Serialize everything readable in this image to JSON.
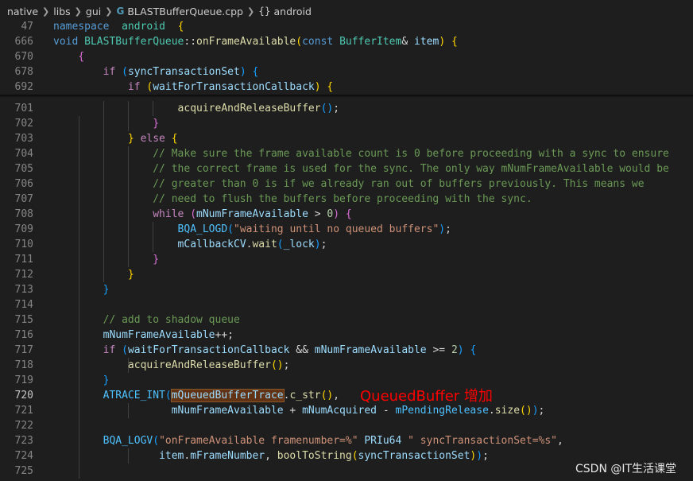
{
  "breadcrumb": {
    "items": [
      "native",
      "libs",
      "gui",
      "BLASTBufferQueue.cpp",
      "android"
    ],
    "file_icon": "cpp-file-icon",
    "symbol_icon": "namespace-braces-icon"
  },
  "editor": {
    "active_line": "720",
    "lines": [
      {
        "n": "47",
        "tokens": [
          [
            "kw",
            "namespace"
          ],
          [
            "",
            "  "
          ],
          [
            "ty",
            "android"
          ],
          [
            "",
            "  "
          ],
          [
            "b1",
            "{"
          ]
        ]
      },
      {
        "n": "666",
        "tokens": [
          [
            "kw",
            "void"
          ],
          [
            "",
            " "
          ],
          [
            "ty",
            "BLASTBufferQueue"
          ],
          [
            "",
            "::"
          ],
          [
            "fn",
            "onFrameAvailable"
          ],
          [
            "b1",
            "("
          ],
          [
            "kw",
            "const"
          ],
          [
            "",
            " "
          ],
          [
            "ty",
            "BufferItem"
          ],
          [
            "",
            "& "
          ],
          [
            "var",
            "item"
          ],
          [
            "b1",
            ")"
          ],
          [
            "",
            " "
          ],
          [
            "b1",
            "{"
          ]
        ]
      },
      {
        "n": "670",
        "tokens": [
          [
            "",
            "    "
          ],
          [
            "b2",
            "{"
          ]
        ]
      },
      {
        "n": "678",
        "tokens": [
          [
            "",
            "        "
          ],
          [
            "ctl",
            "if"
          ],
          [
            "",
            " "
          ],
          [
            "b3",
            "("
          ],
          [
            "var",
            "syncTransactionSet"
          ],
          [
            "b3",
            ")"
          ],
          [
            "",
            " "
          ],
          [
            "b3",
            "{"
          ]
        ]
      },
      {
        "n": "692",
        "tokens": [
          [
            "",
            "            "
          ],
          [
            "ctl",
            "if"
          ],
          [
            "",
            " "
          ],
          [
            "b1",
            "("
          ],
          [
            "var",
            "waitForTransactionCallback"
          ],
          [
            "b1",
            ")"
          ],
          [
            "",
            " "
          ],
          [
            "b1",
            "{"
          ]
        ]
      },
      {
        "n": "701",
        "tokens": [
          [
            "",
            "                    "
          ],
          [
            "fn",
            "acquireAndReleaseBuffer"
          ],
          [
            "b3",
            "()"
          ],
          [
            "",
            ";"
          ]
        ]
      },
      {
        "n": "702",
        "tokens": [
          [
            "",
            "                "
          ],
          [
            "b2",
            "}"
          ]
        ]
      },
      {
        "n": "703",
        "tokens": [
          [
            "",
            "            "
          ],
          [
            "b1",
            "}"
          ],
          [
            "",
            " "
          ],
          [
            "ctl",
            "else"
          ],
          [
            "",
            " "
          ],
          [
            "b1",
            "{"
          ]
        ]
      },
      {
        "n": "704",
        "tokens": [
          [
            "",
            "                "
          ],
          [
            "cm",
            "// Make sure the frame available count is 0 before proceeding with a sync to ensure"
          ]
        ]
      },
      {
        "n": "705",
        "tokens": [
          [
            "",
            "                "
          ],
          [
            "cm",
            "// the correct frame is used for the sync. The only way mNumFrameAvailable would be"
          ]
        ]
      },
      {
        "n": "706",
        "tokens": [
          [
            "",
            "                "
          ],
          [
            "cm",
            "// greater than 0 is if we already ran out of buffers previously. This means we"
          ]
        ]
      },
      {
        "n": "707",
        "tokens": [
          [
            "",
            "                "
          ],
          [
            "cm",
            "// need to flush the buffers before proceeding with the sync."
          ]
        ]
      },
      {
        "n": "708",
        "tokens": [
          [
            "",
            "                "
          ],
          [
            "ctl",
            "while"
          ],
          [
            "",
            " "
          ],
          [
            "b2",
            "("
          ],
          [
            "var",
            "mNumFrameAvailable"
          ],
          [
            "",
            " > "
          ],
          [
            "num",
            "0"
          ],
          [
            "b2",
            ")"
          ],
          [
            "",
            " "
          ],
          [
            "b2",
            "{"
          ]
        ]
      },
      {
        "n": "709",
        "tokens": [
          [
            "",
            "                    "
          ],
          [
            "mem",
            "BQA_LOGD"
          ],
          [
            "b3",
            "("
          ],
          [
            "str",
            "\"waiting until no queued buffers\""
          ],
          [
            "b3",
            ")"
          ],
          [
            "",
            ";"
          ]
        ]
      },
      {
        "n": "710",
        "tokens": [
          [
            "",
            "                    "
          ],
          [
            "var",
            "mCallbackCV"
          ],
          [
            "",
            "."
          ],
          [
            "fn",
            "wait"
          ],
          [
            "b3",
            "("
          ],
          [
            "var",
            "_lock"
          ],
          [
            "b3",
            ")"
          ],
          [
            "",
            ";"
          ]
        ]
      },
      {
        "n": "711",
        "tokens": [
          [
            "",
            "                "
          ],
          [
            "b2",
            "}"
          ]
        ]
      },
      {
        "n": "712",
        "tokens": [
          [
            "",
            "            "
          ],
          [
            "b1",
            "}"
          ]
        ]
      },
      {
        "n": "713",
        "tokens": [
          [
            "",
            "        "
          ],
          [
            "b3",
            "}"
          ]
        ]
      },
      {
        "n": "714",
        "tokens": []
      },
      {
        "n": "715",
        "tokens": [
          [
            "",
            "        "
          ],
          [
            "cm",
            "// add to shadow queue"
          ]
        ]
      },
      {
        "n": "716",
        "tokens": [
          [
            "",
            "        "
          ],
          [
            "var",
            "mNumFrameAvailable"
          ],
          [
            "",
            "++;"
          ]
        ]
      },
      {
        "n": "717",
        "tokens": [
          [
            "",
            "        "
          ],
          [
            "ctl",
            "if"
          ],
          [
            "",
            " "
          ],
          [
            "b3",
            "("
          ],
          [
            "var",
            "waitForTransactionCallback"
          ],
          [
            "",
            " && "
          ],
          [
            "var",
            "mNumFrameAvailable"
          ],
          [
            "",
            " >= "
          ],
          [
            "num",
            "2"
          ],
          [
            "b3",
            ")"
          ],
          [
            "",
            " "
          ],
          [
            "b3",
            "{"
          ]
        ]
      },
      {
        "n": "718",
        "tokens": [
          [
            "",
            "            "
          ],
          [
            "fn",
            "acquireAndReleaseBuffer"
          ],
          [
            "b1",
            "()"
          ],
          [
            "",
            ";"
          ]
        ]
      },
      {
        "n": "719",
        "tokens": [
          [
            "",
            "        "
          ],
          [
            "b3",
            "}"
          ]
        ]
      },
      {
        "n": "720",
        "tokens": [
          [
            "",
            "        "
          ],
          [
            "mem",
            "ATRACE_INT"
          ],
          [
            "b3",
            "("
          ],
          [
            "var hl",
            "mQueuedBufferTrace"
          ],
          [
            "",
            "."
          ],
          [
            "fn",
            "c_str"
          ],
          [
            "b1",
            "()"
          ],
          [
            "",
            ","
          ]
        ]
      },
      {
        "n": "721",
        "tokens": [
          [
            "",
            "                   "
          ],
          [
            "var",
            "mNumFrameAvailable"
          ],
          [
            "",
            " + "
          ],
          [
            "var",
            "mNumAcquired"
          ],
          [
            "",
            " - "
          ],
          [
            "mem",
            "mPendingRelease"
          ],
          [
            "",
            "."
          ],
          [
            "fn",
            "size"
          ],
          [
            "b1",
            "()"
          ],
          [
            "b3",
            ")"
          ],
          [
            "",
            ";"
          ]
        ]
      },
      {
        "n": "722",
        "tokens": []
      },
      {
        "n": "723",
        "tokens": [
          [
            "",
            "        "
          ],
          [
            "mem",
            "BQA_LOGV"
          ],
          [
            "b3",
            "("
          ],
          [
            "str",
            "\"onFrameAvailable framenumber=%\""
          ],
          [
            "",
            " "
          ],
          [
            "var",
            "PRIu64"
          ],
          [
            "",
            " "
          ],
          [
            "str",
            "\" syncTransactionSet=%s\""
          ],
          [
            "",
            ","
          ]
        ]
      },
      {
        "n": "724",
        "tokens": [
          [
            "",
            "                 "
          ],
          [
            "var",
            "item"
          ],
          [
            "",
            "."
          ],
          [
            "var",
            "mFrameNumber"
          ],
          [
            "",
            ", "
          ],
          [
            "fn",
            "boolToString"
          ],
          [
            "b1",
            "("
          ],
          [
            "var",
            "syncTransactionSet"
          ],
          [
            "b1",
            ")"
          ],
          [
            "b3",
            ")"
          ],
          [
            "",
            ";"
          ]
        ]
      },
      {
        "n": "725",
        "tokens": []
      }
    ]
  },
  "annotation": {
    "text": "QueuedBuffer 增加",
    "color": "#ff0000"
  },
  "watermark": {
    "text": "CSDN @IT生活课堂"
  }
}
